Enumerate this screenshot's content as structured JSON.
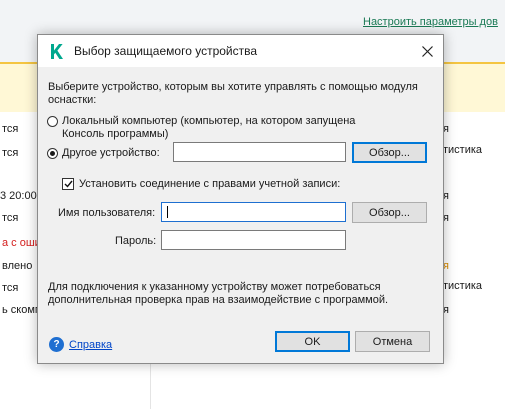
{
  "background": {
    "header_link": "Настроить параметры дов",
    "left_texts": [
      "тся",
      "тся",
      "3 20:00",
      "тся",
      "а с оши",
      "влено",
      "тся",
      "ь скомп"
    ],
    "right_texts": [
      "я",
      "тистика",
      "я",
      "я",
      "я",
      "тистика",
      "я"
    ]
  },
  "dialog": {
    "title": "Выбор защищаемого устройства",
    "description": "Выберите устройство, которым вы хотите управлять с помощью модуля оснастки:",
    "radio_local": "Локальный компьютер (компьютер, на котором запущена Консоль программы)",
    "radio_other": "Другое устройство:",
    "device_value": "",
    "browse_device": "Обзор...",
    "checkbox_label": "Установить соединение с правами учетной записи:",
    "username_label": "Имя пользователя:",
    "username_value": "",
    "browse_user": "Обзор...",
    "password_label": "Пароль:",
    "password_value": "",
    "note": "Для подключения к указанному устройству может потребоваться дополнительная проверка прав на взаимодействие с программой.",
    "help": "Справка",
    "ok": "OK",
    "cancel": "Отмена"
  },
  "colors": {
    "brand_icon": "#00a88e",
    "link": "#0045c8",
    "focus": "#1e6fd0",
    "accent_yellow": "#f4c542"
  }
}
